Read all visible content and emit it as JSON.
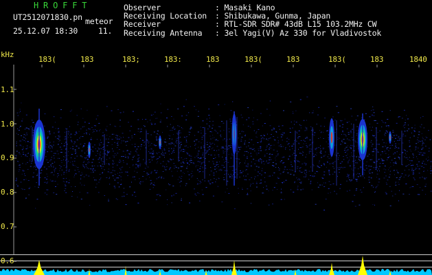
{
  "header": {
    "logo": "H R O F F T",
    "filename": "UT2512071830.pn",
    "mode": "meteor",
    "date_time": "25.12.07 18:30",
    "count": "11.",
    "info": [
      {
        "label": "Observer",
        "value": ": Masaki Kano"
      },
      {
        "label": "Receiving Location",
        "value": ": Shibukawa, Gunma, Japan"
      },
      {
        "label": "Receiver",
        "value": ": RTL-SDR SDR# 43dB L15 103.2MHz CW"
      },
      {
        "label": "Receiving Antenna",
        "value": ": 3el Yagi(V) Az 330 for Vladivostok"
      }
    ]
  },
  "axes": {
    "y_unit": "kHz",
    "x_ticks": [
      "183(",
      "183",
      "183;",
      "183:",
      "183",
      "183(",
      "183",
      "183(",
      "183",
      "1840"
    ],
    "y_ticks": [
      "1.1",
      "1.0",
      "0.9",
      "0.8",
      "0.7",
      "0.6"
    ]
  },
  "colors": {
    "background": "#000000",
    "noise": "#1b2a9a",
    "echo_core": "#ff2a2a",
    "power_bars": "#ffff00",
    "baseline": "#00d8ff",
    "grid": "#c9c9c9"
  }
}
